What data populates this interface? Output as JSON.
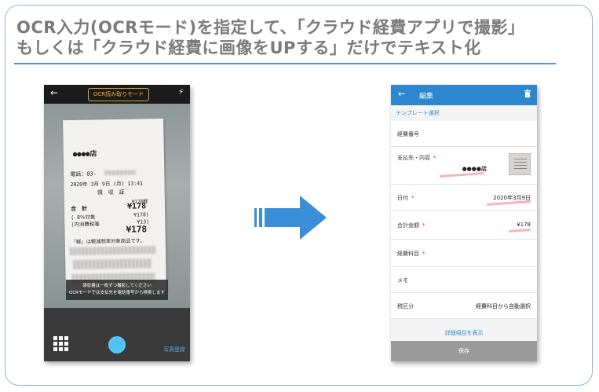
{
  "headline": {
    "line1": "OCR入力(OCRモード)を指定して、「クラウド経費アプリで撮影」",
    "line2": "もしくは「クラウド経費に画像をUPする」だけでテキスト化"
  },
  "camera_screen": {
    "mode_label": "OCR読み取りモード",
    "receipt": {
      "shop": "●●●●店",
      "phone": "電話：03-",
      "datetime": "2020年 3月 9日 (月) 13:41",
      "title": "領　収　証",
      "small_amount": "¥178軽",
      "total_label": "合　計",
      "total_value": "¥178",
      "tax_target_label": "( 8％対象",
      "tax_target_value": "¥178)",
      "tax_label": "(内消費税等",
      "tax_value": "¥13)",
      "big_total": "¥178",
      "note": "「軽」は軽減税率対象商品です。"
    },
    "hint_line1": "領収書は一枚ずつ撮影してください",
    "hint_line2": "OCRモードでは支払先を電話番号から検索します",
    "photo_register": "写真登録"
  },
  "edit_screen": {
    "title": "編集",
    "template_select": "テンプレート選択",
    "fields": [
      {
        "label": "経費番号",
        "required": false,
        "value": ""
      },
      {
        "label": "支払先・内容",
        "required": true,
        "value": "●●●●店"
      },
      {
        "label": "日付",
        "required": true,
        "value": "2020年3月9日"
      },
      {
        "label": "合計金額",
        "required": true,
        "value": "¥178"
      },
      {
        "label": "経費科目",
        "required": true,
        "value": ""
      },
      {
        "label": "メモ",
        "required": false,
        "value": ""
      },
      {
        "label": "税区分",
        "required": false,
        "value": "経費科目から自動選択"
      }
    ],
    "required_mark": "*",
    "show_details": "詳細項目を表示",
    "save": "保存"
  },
  "colors": {
    "accent_blue": "#2d86d0",
    "arrow_blue": "#3a8fd6",
    "headline_gray": "#7a7a7a",
    "ocr_highlight": "#f3b5bf"
  }
}
